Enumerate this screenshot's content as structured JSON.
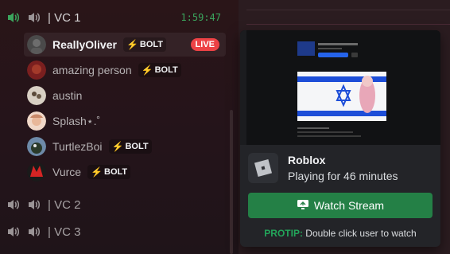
{
  "voice_channels": [
    {
      "name": "VC 1",
      "timer": "1:59:47"
    },
    {
      "name": "VC 2"
    },
    {
      "name": "VC 3"
    }
  ],
  "users": [
    {
      "name": "ReallyOliver",
      "badge": "BOLT",
      "live": "LIVE"
    },
    {
      "name": "amazing person",
      "badge": "BOLT"
    },
    {
      "name": "austin"
    },
    {
      "name": "Splash⋆.˚"
    },
    {
      "name": "TurtlezBoi",
      "badge": "BOLT"
    },
    {
      "name": "Vurce",
      "badge": "BOLT"
    }
  ],
  "stream_card": {
    "game": "Roblox",
    "activity": "Playing for 46 minutes",
    "watch_label": "Watch Stream",
    "protip_label": "PROTIP:",
    "protip_text": "Double click user to watch"
  },
  "colors": {
    "accent_green": "#248046",
    "live_red": "#ed4245",
    "timer_green": "#3ba55d",
    "bolt_yellow": "#f0c419"
  },
  "icons": [
    "speaker-icon",
    "bolt-icon",
    "roblox-logo-icon",
    "screen-share-icon"
  ]
}
